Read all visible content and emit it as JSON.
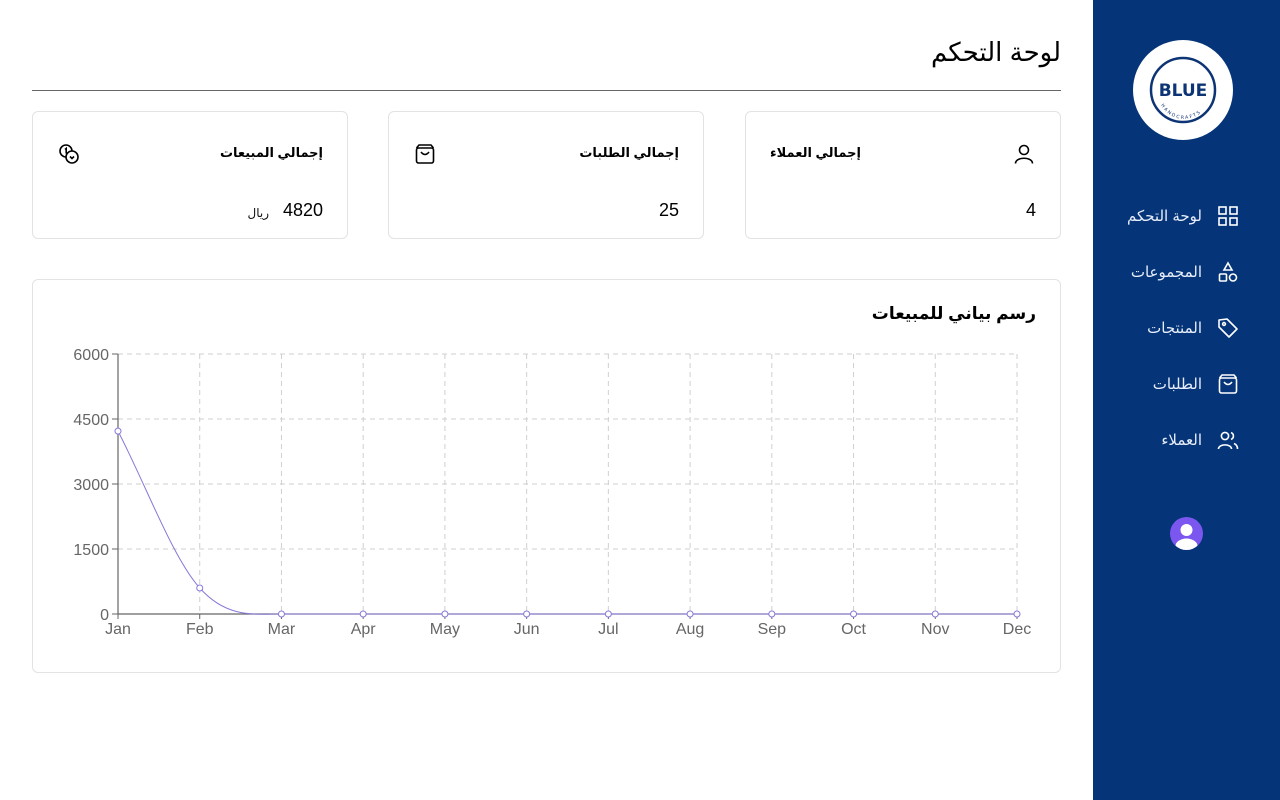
{
  "page": {
    "title": "لوحة التحكم"
  },
  "sidebar": {
    "logo": {
      "brand": "BLUE",
      "tagline": "HANDCRAFTS"
    },
    "items": [
      {
        "label": "لوحة التحكم",
        "icon": "dashboard-grid-icon"
      },
      {
        "label": "المجموعات",
        "icon": "shapes-icon"
      },
      {
        "label": "المنتجات",
        "icon": "tag-icon"
      },
      {
        "label": "الطلبات",
        "icon": "shopping-bag-icon"
      },
      {
        "label": "العملاء",
        "icon": "users-icon"
      }
    ],
    "avatar_icon": "user-avatar-icon"
  },
  "cards": {
    "customers": {
      "title": "إجمالي العملاء",
      "value": "4",
      "icon": "user-icon"
    },
    "orders": {
      "title": "إجمالي الطلبات",
      "value": "25",
      "icon": "shopping-bag-icon"
    },
    "sales": {
      "title": "إجمالي المبيعات",
      "value": "4820",
      "currency": "ريال",
      "icon": "coins-icon"
    }
  },
  "chart": {
    "title": "رسم بياني للمبيعات"
  },
  "colors": {
    "sidebar_bg": "#053578",
    "line": "#8878d8",
    "avatar": "#7b57f0"
  },
  "chart_data": {
    "type": "line",
    "title": "رسم بياني للمبيعات",
    "categories": [
      "Jan",
      "Feb",
      "Mar",
      "Apr",
      "May",
      "Jun",
      "Jul",
      "Aug",
      "Sep",
      "Oct",
      "Nov",
      "Dec"
    ],
    "values": [
      4220,
      600,
      0,
      0,
      0,
      0,
      0,
      0,
      0,
      0,
      0,
      0
    ],
    "yticks": [
      0,
      1500,
      3000,
      4500,
      6000
    ],
    "ylim": [
      0,
      6000
    ],
    "grid": true,
    "curve": "smooth"
  }
}
